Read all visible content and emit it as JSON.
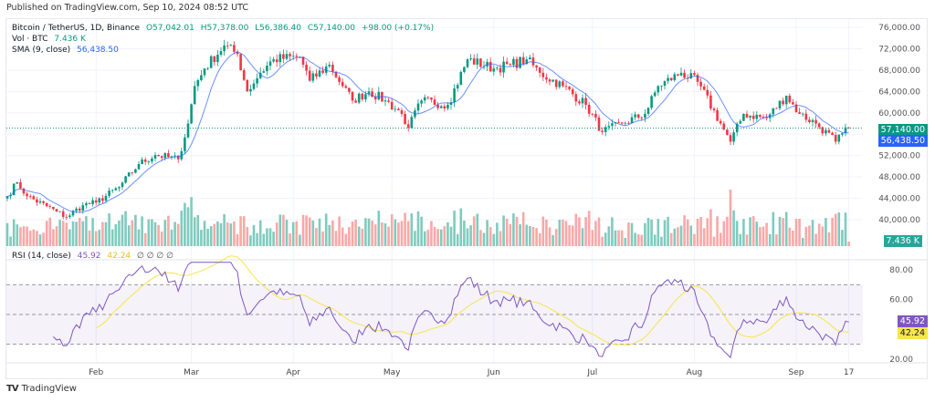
{
  "published": "Published on TradingView.com, Sep 10, 2024 08:52 UTC",
  "legend": {
    "symbol": "Bitcoin / TetherUS, 1D, Binance",
    "open": "O57,042.01",
    "high": "H57,378.00",
    "low": "L56,386.40",
    "close": "C57,140.00",
    "change": "+98.00 (+0.17%)",
    "vol_label": "Vol · BTC",
    "vol_value": "7.436 K",
    "sma_label": "SMA (9, close)",
    "sma_value": "56,438.50",
    "rsi_label": "RSI (14, close)",
    "rsi_value": "45.92",
    "rsi_ma_value": "42.24",
    "rsi_extra": "∅ ∅ ∅ ∅"
  },
  "tags": {
    "price": "57,140.00",
    "sma": "56,438.50",
    "volume": "7.436 K",
    "rsi": "45.92",
    "rsi_ma": "42.24"
  },
  "footer": {
    "logo": "TV",
    "brand": "TradingView"
  },
  "colors": {
    "up": "#089981",
    "down": "#f23645",
    "sma": "#2962ff",
    "rsi": "#7e57c2",
    "rsi_ma": "#f7e54a"
  },
  "chart_data": {
    "type": "candlestick",
    "title": "Bitcoin / TetherUS, 1D, Binance",
    "x_unit": "days since Jan 5, 2024",
    "close_keypoints": [
      [
        0,
        44400
      ],
      [
        3,
        47000
      ],
      [
        6,
        44400
      ],
      [
        15,
        41500
      ],
      [
        18,
        40500
      ],
      [
        23,
        42700
      ],
      [
        27,
        43200
      ],
      [
        34,
        46100
      ],
      [
        40,
        50400
      ],
      [
        45,
        52100
      ],
      [
        52,
        51300
      ],
      [
        55,
        58000
      ],
      [
        57,
        65000
      ],
      [
        60,
        68300
      ],
      [
        66,
        72600
      ],
      [
        70,
        71000
      ],
      [
        73,
        64000
      ],
      [
        77,
        67500
      ],
      [
        81,
        70000
      ],
      [
        89,
        70500
      ],
      [
        92,
        66000
      ],
      [
        98,
        69000
      ],
      [
        102,
        65000
      ],
      [
        105,
        62300
      ],
      [
        110,
        64000
      ],
      [
        115,
        62300
      ],
      [
        120,
        59800
      ],
      [
        122,
        57200
      ],
      [
        126,
        62300
      ],
      [
        134,
        61500
      ],
      [
        140,
        70000
      ],
      [
        148,
        68300
      ],
      [
        153,
        69000
      ],
      [
        158,
        70000
      ],
      [
        162,
        67500
      ],
      [
        169,
        65000
      ],
      [
        176,
        61500
      ],
      [
        181,
        56400
      ],
      [
        187,
        58000
      ],
      [
        194,
        59800
      ],
      [
        198,
        65000
      ],
      [
        205,
        67500
      ],
      [
        210,
        65800
      ],
      [
        217,
        58000
      ],
      [
        220,
        54600
      ],
      [
        224,
        59800
      ],
      [
        231,
        59000
      ],
      [
        237,
        63200
      ],
      [
        241,
        59800
      ],
      [
        246,
        58000
      ],
      [
        252,
        54600
      ],
      [
        256,
        57140
      ]
    ],
    "price_axis": [
      "76,000.00",
      "72,000.00",
      "68,000.00",
      "64,000.00",
      "60,000.00",
      "52,000.00",
      "48,000.00",
      "44,000.00",
      "40,000.00"
    ],
    "price_range": [
      36000,
      78000
    ],
    "rsi_axis": [
      "80.00",
      "60.00",
      "20.00"
    ],
    "rsi_range": [
      20,
      80
    ],
    "rsi_bands": [
      70,
      50,
      30
    ],
    "time_axis": [
      "Feb",
      "Mar",
      "Apr",
      "May",
      "Jun",
      "Jul",
      "Aug",
      "Sep",
      "17"
    ],
    "time_axis_days": [
      27,
      56,
      87,
      117,
      148,
      178,
      209,
      240,
      256
    ]
  }
}
